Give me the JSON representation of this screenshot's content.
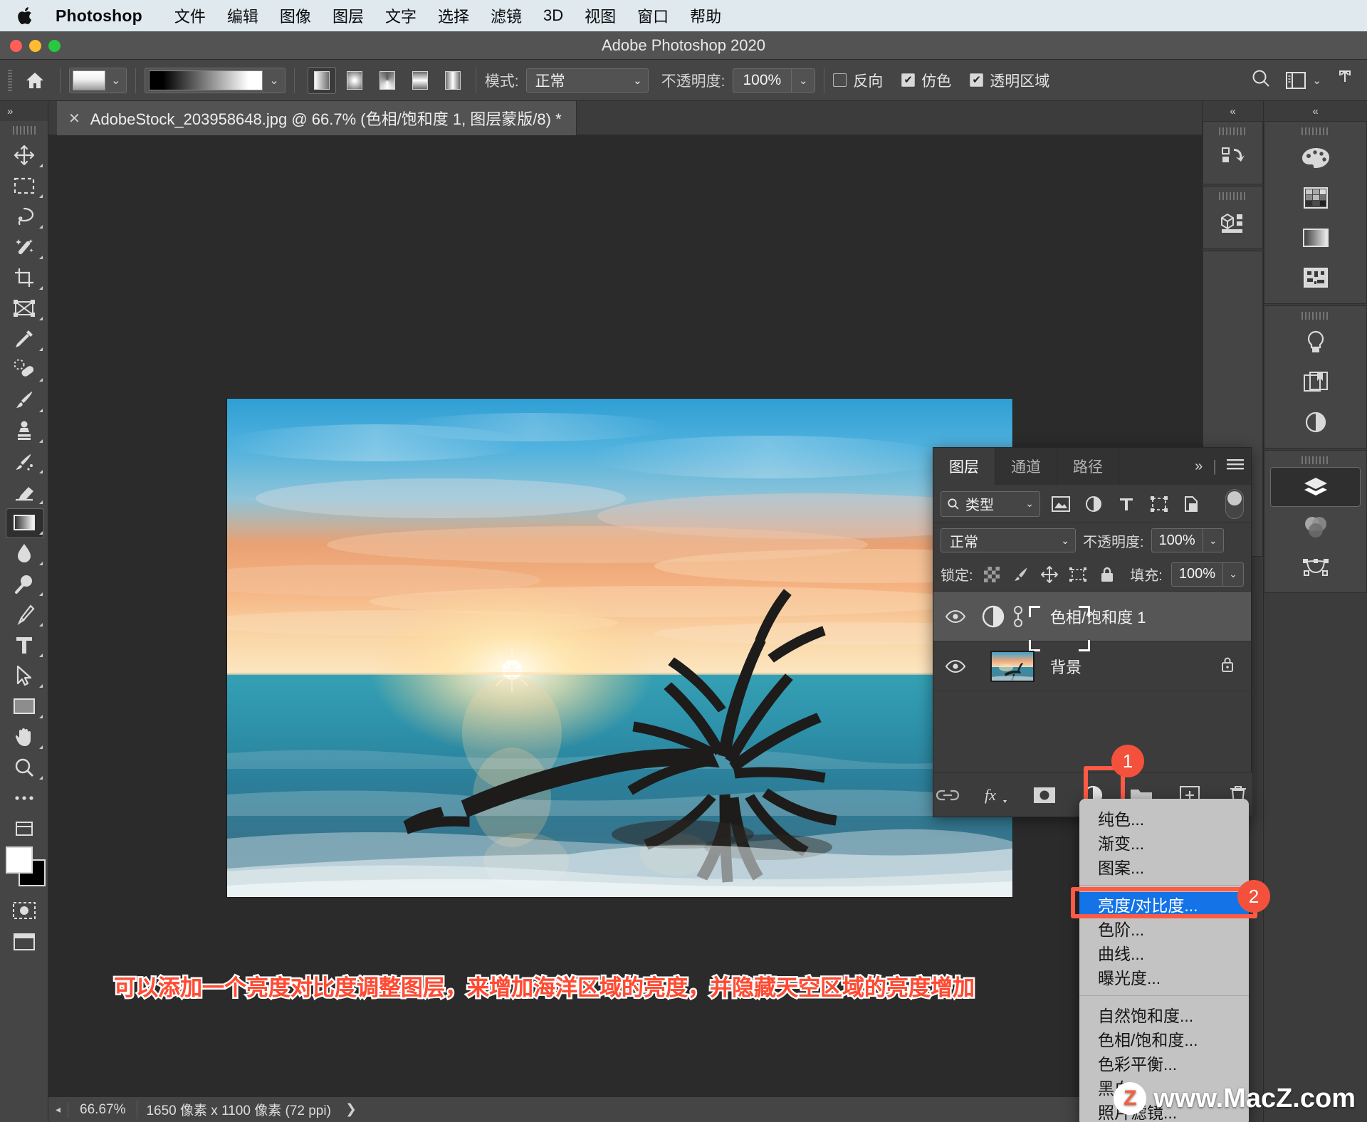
{
  "macbar": {
    "app_name": "Photoshop",
    "apple_icon": "apple-logo",
    "menus": [
      "文件",
      "编辑",
      "图像",
      "图层",
      "文字",
      "选择",
      "滤镜",
      "3D",
      "视图",
      "窗口",
      "帮助"
    ]
  },
  "window": {
    "title": "Adobe Photoshop 2020"
  },
  "options_bar": {
    "home_icon": "home-icon",
    "preset_caret": "chevron-down-icon",
    "gradient_caret": "chevron-down-icon",
    "gradient_types": [
      "linear-gradient",
      "radial-gradient",
      "angle-gradient",
      "reflected-gradient",
      "diamond-gradient"
    ],
    "mode_label": "模式:",
    "mode_value": "正常",
    "opacity_label": "不透明度:",
    "opacity_value": "100%",
    "reverse_label": "反向",
    "reverse_checked": false,
    "dither_label": "仿色",
    "dither_checked": true,
    "transparency_label": "透明区域",
    "transparency_checked": true,
    "search_icon": "search-icon",
    "workspace_icon": "workspace-icon",
    "share_icon": "share-icon"
  },
  "toolbar": {
    "collapse_icon": "chevron-double-right-icon",
    "tools": [
      {
        "name": "move-tool",
        "icon": "move-icon"
      },
      {
        "name": "marquee-tool",
        "icon": "rectangular-marquee-icon"
      },
      {
        "name": "lasso-tool",
        "icon": "lasso-icon"
      },
      {
        "name": "quick-selection-tool",
        "icon": "magic-wand-icon"
      },
      {
        "name": "crop-tool",
        "icon": "crop-icon"
      },
      {
        "name": "frame-tool",
        "icon": "frame-icon"
      },
      {
        "name": "eyedropper-tool",
        "icon": "eyedropper-icon"
      },
      {
        "name": "healing-brush-tool",
        "icon": "spot-healing-icon"
      },
      {
        "name": "brush-tool",
        "icon": "brush-icon"
      },
      {
        "name": "clone-stamp-tool",
        "icon": "clone-stamp-icon"
      },
      {
        "name": "history-brush-tool",
        "icon": "history-brush-icon"
      },
      {
        "name": "eraser-tool",
        "icon": "eraser-icon"
      },
      {
        "name": "gradient-tool",
        "icon": "gradient-icon",
        "selected": true
      },
      {
        "name": "blur-tool",
        "icon": "water-drop-icon"
      },
      {
        "name": "dodge-tool",
        "icon": "dodge-icon"
      },
      {
        "name": "pen-tool",
        "icon": "pen-icon"
      },
      {
        "name": "type-tool",
        "icon": "text-t-icon"
      },
      {
        "name": "path-selection-tool",
        "icon": "arrow-cursor-icon"
      },
      {
        "name": "rectangle-tool",
        "icon": "rectangle-icon"
      },
      {
        "name": "hand-tool",
        "icon": "hand-icon"
      },
      {
        "name": "zoom-tool",
        "icon": "magnifier-icon"
      },
      {
        "name": "more-tools",
        "icon": "ellipsis-icon"
      },
      {
        "name": "edit-toolbar",
        "icon": "edit-toolbar-icon"
      }
    ],
    "foreground_color": "#ffffff",
    "background_color": "#000000",
    "quickmask_icon": "quick-mask-icon",
    "screenmode_icon": "screen-mode-icon"
  },
  "document": {
    "close_icon": "close-icon",
    "tab_title": "AdobeStock_203958648.jpg @ 66.7% (色相/饱和度 1, 图层蒙版/8) *"
  },
  "annotation": {
    "text": "可以添加一个亮度对比度调整图层，来增加海洋区域的亮度，并隐藏天空区域的亮度增加",
    "color": "#ff4b33",
    "stroke_color": "#ffffff"
  },
  "status_bar": {
    "left_arrow": "chevron-left-icon",
    "zoom": "66.67%",
    "dimensions": "1650 像素 x 1100 像素 (72 ppi)",
    "chevron": "chevron-right-icon"
  },
  "right_dock": {
    "collapse_icon_left": "chevron-double-left-icon",
    "collapse_icon_right": "chevron-double-left-icon",
    "col1_groups": [
      {
        "items": [
          {
            "name": "history-panel-icon"
          }
        ]
      },
      {
        "items": [
          {
            "name": "3d-panel-icon"
          }
        ]
      }
    ],
    "col2_groups": [
      {
        "items": [
          {
            "name": "color-palette-icon"
          },
          {
            "name": "swatches-icon"
          },
          {
            "name": "gradients-icon"
          },
          {
            "name": "patterns-icon"
          }
        ]
      },
      {
        "items": [
          {
            "name": "learn-bulb-icon"
          },
          {
            "name": "libraries-icon"
          },
          {
            "name": "adjustments-icon"
          }
        ]
      },
      {
        "items": [
          {
            "name": "layers-panel-icon",
            "active": true
          },
          {
            "name": "channels-panel-icon"
          },
          {
            "name": "paths-panel-icon"
          }
        ]
      }
    ]
  },
  "layers_panel": {
    "tabs": [
      {
        "label": "图层",
        "active": true
      },
      {
        "label": "通道",
        "active": false
      },
      {
        "label": "路径",
        "active": false
      }
    ],
    "overflow_icon": "chevron-double-right-icon",
    "menu_icon": "hamburger-menu-icon",
    "filter": {
      "search_icon": "search-icon",
      "kind_label": "类型",
      "caret": "chevron-down-icon",
      "icons": [
        "pixel-filter-icon",
        "adjustment-filter-icon",
        "type-filter-icon",
        "shape-filter-icon",
        "smart-object-filter-icon"
      ],
      "toggle": "filter-toggle"
    },
    "blend_mode_label": "正常",
    "opacity_label": "不透明度:",
    "opacity_value": "100%",
    "lock_label": "锁定:",
    "lock_icons": [
      "lock-transparent-pixels-icon",
      "lock-image-pixels-icon",
      "lock-position-icon",
      "lock-artboard-icon",
      "lock-all-icon"
    ],
    "fill_label": "填充:",
    "fill_value": "100%",
    "layers": [
      {
        "name": "色相/饱和度 1",
        "type": "adjustment",
        "selected": true,
        "visible": true,
        "eye_icon": "eye-icon",
        "adjustment_icon": "hue-saturation-icon",
        "link_icon": "link-mask-icon",
        "has_mask": true
      },
      {
        "name": "背景",
        "type": "image",
        "selected": false,
        "visible": true,
        "eye_icon": "eye-icon",
        "locked": true,
        "lock_icon": "lock-icon"
      }
    ],
    "bottom_buttons": [
      {
        "name": "link-layers-button",
        "icon": "chain-link-icon"
      },
      {
        "name": "layer-style-button",
        "icon": "fx-icon"
      },
      {
        "name": "add-layer-mask-button",
        "icon": "mask-icon"
      },
      {
        "name": "new-adjustment-layer-button",
        "icon": "half-circle-icon",
        "highlighted": true
      },
      {
        "name": "new-group-button",
        "icon": "folder-icon"
      },
      {
        "name": "new-layer-button",
        "icon": "plus-square-icon"
      },
      {
        "name": "delete-layer-button",
        "icon": "trash-icon"
      }
    ]
  },
  "context_menu": {
    "groups": [
      [
        "纯色...",
        "渐变...",
        "图案..."
      ],
      [
        "亮度/对比度...",
        "色阶...",
        "曲线...",
        "曝光度..."
      ],
      [
        "自然饱和度...",
        "色相/饱和度...",
        "色彩平衡...",
        "黑白...",
        "照片滤镜..."
      ]
    ],
    "highlighted": "亮度/对比度...",
    "highlight_color": "#1473e6"
  },
  "callouts": [
    {
      "number": "1",
      "target": "new-adjustment-layer-button"
    },
    {
      "number": "2",
      "target": "brightness-contrast-menu-item"
    }
  ],
  "watermark": {
    "badge": "Z",
    "text": "www.MacZ.com"
  }
}
